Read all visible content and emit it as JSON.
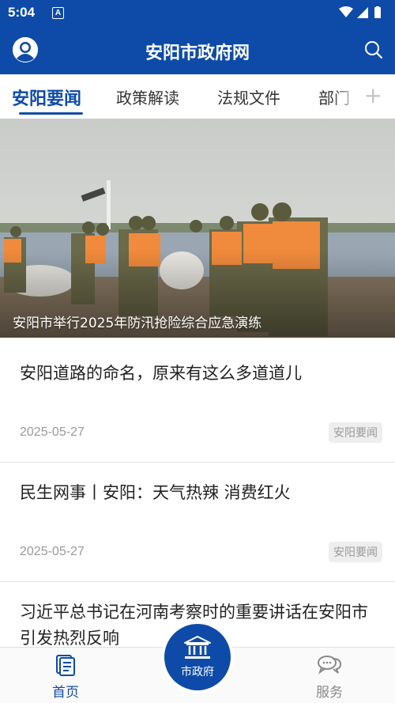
{
  "status_bar": {
    "time": "5:04",
    "notification_glyph": "A"
  },
  "app_bar": {
    "title": "安阳市政府网"
  },
  "tabs": [
    {
      "label": "安阳要闻",
      "active": true
    },
    {
      "label": "政策解读",
      "active": false
    },
    {
      "label": "法规文件",
      "active": false
    },
    {
      "label": "部门",
      "active": false
    }
  ],
  "tab_add_label": "+",
  "banner": {
    "caption": "安阳市举行2025年防汛抢险综合应急演练"
  },
  "news": [
    {
      "title": "安阳道路的命名，原来有这么多道道儿",
      "date": "2025-05-27",
      "tag": "安阳要闻"
    },
    {
      "title": "民生网事丨安阳：天气热辣 消费红火",
      "date": "2025-05-27",
      "tag": "安阳要闻"
    },
    {
      "title": "习近平总书记在河南考察时的重要讲话在安阳市引发热烈反响"
    }
  ],
  "bottom_nav": {
    "home_label": "首页",
    "center_label": "市政府",
    "service_label": "服务"
  },
  "colors": {
    "primary": "#0e4ba8",
    "inactive": "#8a8a8a",
    "tag_bg": "#eeeeee"
  },
  "icons": [
    "user-avatar-icon",
    "search-icon",
    "plus-icon",
    "home-document-icon",
    "government-building-icon",
    "chat-bubbles-icon",
    "wifi-icon",
    "signal-icon",
    "battery-icon"
  ]
}
